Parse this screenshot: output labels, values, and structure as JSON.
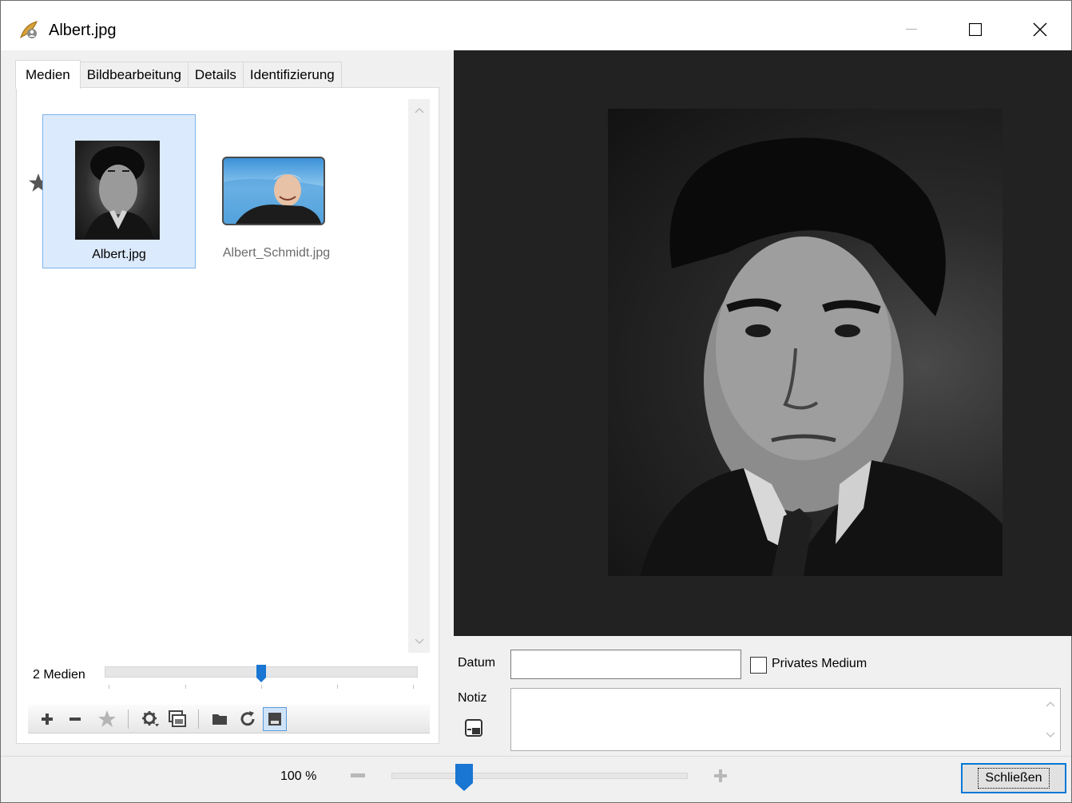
{
  "window": {
    "title": "Albert.jpg",
    "icon": "app-feather-icon"
  },
  "tabs": [
    {
      "label": "Medien",
      "active": true
    },
    {
      "label": "Bildbearbeitung",
      "active": false
    },
    {
      "label": "Details",
      "active": false
    },
    {
      "label": "Identifizierung",
      "active": false
    }
  ],
  "media": {
    "items": [
      {
        "filename": "Albert.jpg",
        "selected": true,
        "primary": true
      },
      {
        "filename": "Albert_Schmidt.jpg",
        "selected": false,
        "primary": false
      }
    ],
    "count_label": "2 Medien",
    "thumbnail_size_level": 0.5
  },
  "toolbar": {
    "icons": [
      "add-icon",
      "remove-icon",
      "star-icon",
      "settings-icon",
      "gallery-icon",
      "folder-icon",
      "refresh-icon",
      "save-view-icon"
    ]
  },
  "details": {
    "date_label": "Datum",
    "date_value": "",
    "private_label": "Privates Medium",
    "private_checked": false,
    "note_label": "Notiz",
    "note_value": ""
  },
  "zoom": {
    "label": "100 %",
    "level": 0.24
  },
  "buttons": {
    "close_label": "Schließen"
  },
  "colors": {
    "selection_bg": "#dbeafd",
    "selection_border": "#7eb4ea",
    "accent": "#0078d7",
    "preview_bg": "#222222"
  }
}
